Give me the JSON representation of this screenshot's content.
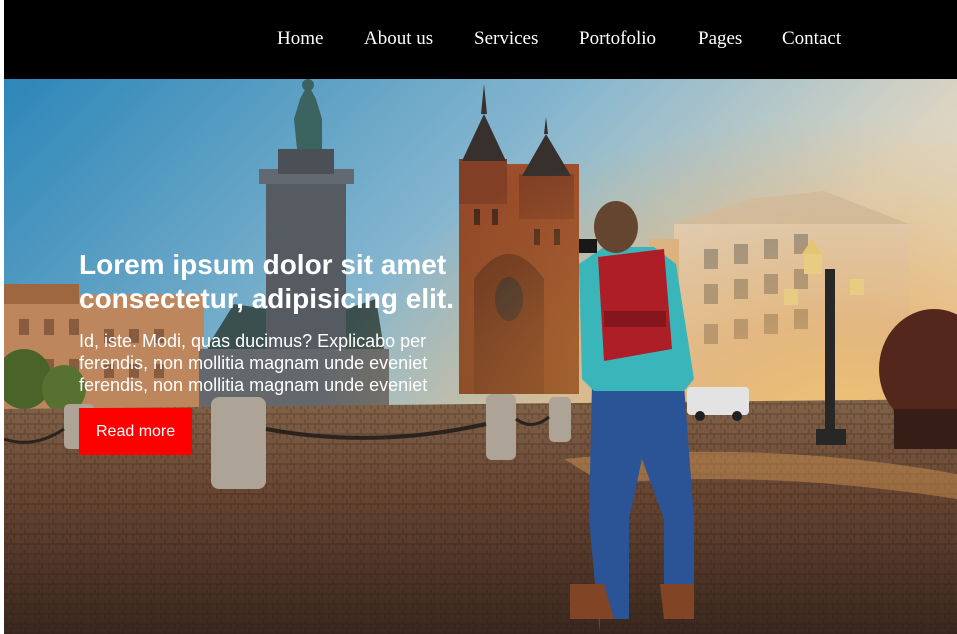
{
  "nav": {
    "items": [
      {
        "label": "Home"
      },
      {
        "label": "About us"
      },
      {
        "label": "Services"
      },
      {
        "label": "Portofolio"
      },
      {
        "label": "Pages"
      },
      {
        "label": "Contact"
      }
    ]
  },
  "hero": {
    "title_line1": "Lorem ipsum dolor sit amet",
    "title_line2": "consectetur, adipisicing elit.",
    "text": "Id, iste. Modi, quas ducimus? Explicabo per ferendis, non mollitia magnam unde eveniet ferendis, non mollitia magnam unde eveniet",
    "button_label": "Read more"
  },
  "colors": {
    "navbar_bg": "#000000",
    "button_bg": "#ff0000",
    "text": "#ffffff"
  }
}
